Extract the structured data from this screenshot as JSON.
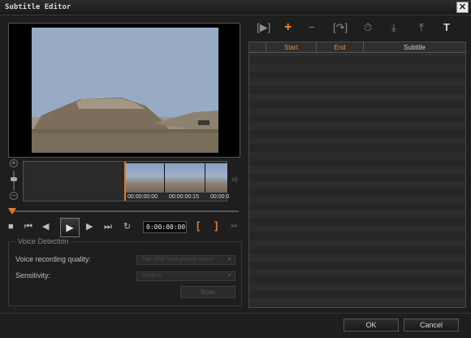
{
  "window": {
    "title": "Subtitle Editor",
    "close_glyph": "✕"
  },
  "preview": {
    "timecode": "0:00:00:00"
  },
  "timeline": {
    "times": [
      "00:00:00:00",
      "00:00:00:15",
      "00:00:0"
    ],
    "playhead_fraction": 0.0
  },
  "transport": {
    "stop": "■",
    "prev_clip": "⏮",
    "prev_frame": "◀",
    "play": "▶",
    "next_frame": "▶",
    "next_clip": "⏭",
    "loop": "↻",
    "mark_in": "[",
    "mark_out": "]",
    "split": "✂",
    "zoom_in": "+",
    "zoom_out": "−"
  },
  "voice_detection": {
    "legend": "Voice Detection",
    "quality_label": "Voice recording quality:",
    "quality_value": "Fair (little background noise)",
    "sensitivity_label": "Sensitivity:",
    "sensitivity_value": "Medium",
    "scan_label": "Scan"
  },
  "subtitle_list": {
    "columns": {
      "start": "Start",
      "end": "End",
      "subtitle": "Subtitle"
    },
    "rows": []
  },
  "toolbar_icons": {
    "play_subtitle": "[▶]",
    "add": "+",
    "remove": "−",
    "jump": "[↷]",
    "time_offset": "⏱",
    "import": "⤓",
    "export": "⤒",
    "text_options": "T"
  },
  "footer": {
    "ok_label": "OK",
    "cancel_label": "Cancel"
  },
  "colors": {
    "accent": "#f08a1e",
    "background": "#1e1e1e"
  }
}
